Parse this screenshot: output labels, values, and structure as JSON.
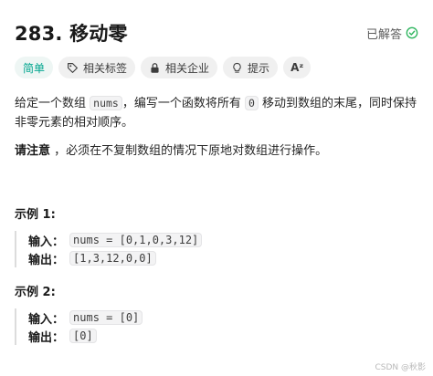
{
  "problem": {
    "number_title": "283. 移动零",
    "solved_label": "已解答"
  },
  "tags": {
    "difficulty": "简单",
    "related_tags": "相关标签",
    "related_companies": "相关企业",
    "hint": "提示",
    "translate": "Aᶻ"
  },
  "description": {
    "p1_a": "给定一个数组 ",
    "p1_code": "nums",
    "p1_b": "，编写一个函数将所有 ",
    "p1_code2": "0",
    "p1_c": " 移动到数组的末尾，同时保持非零元素的相对顺序。",
    "note_bold": "请注意",
    "note_rest": " ，必须在不复制数组的情况下原地对数组进行操作。"
  },
  "examples": [
    {
      "title": "示例 1:",
      "input_label": "输入：",
      "input_value": "nums = [0,1,0,3,12]",
      "output_label": "输出：",
      "output_value": "[1,3,12,0,0]"
    },
    {
      "title": "示例 2:",
      "input_label": "输入：",
      "input_value": "nums = [0]",
      "output_label": "输出：",
      "output_value": "[0]"
    }
  ],
  "watermark": "CSDN @秋影",
  "colors": {
    "easy": "#00a58e",
    "solved_check": "#2db55d"
  }
}
